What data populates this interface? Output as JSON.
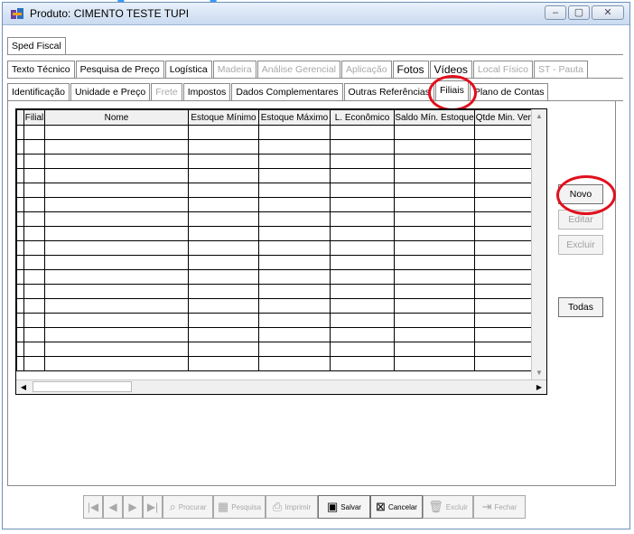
{
  "window": {
    "title": "Produto: CIMENTO TESTE TUPI",
    "controls": [
      "–",
      "▢",
      "✕"
    ]
  },
  "tabs_row1": [
    "Sped Fiscal"
  ],
  "tabs_row2": [
    {
      "label": "Texto Técnico",
      "disabled": false
    },
    {
      "label": "Pesquisa de Preço",
      "disabled": false
    },
    {
      "label": "Logística",
      "disabled": false
    },
    {
      "label": "Madeira",
      "disabled": true
    },
    {
      "label": "Análise Gerencial",
      "disabled": true
    },
    {
      "label": "Aplicação",
      "disabled": true
    },
    {
      "label": "Fotos",
      "disabled": false
    },
    {
      "label": "Vídeos",
      "disabled": false
    },
    {
      "label": "Local Físico",
      "disabled": true
    },
    {
      "label": "ST - Pauta",
      "disabled": true
    }
  ],
  "tabs_row3": [
    {
      "label": "Identificação",
      "disabled": false
    },
    {
      "label": "Unidade e Preço",
      "disabled": false
    },
    {
      "label": "Frete",
      "disabled": true
    },
    {
      "label": "Impostos",
      "disabled": false
    },
    {
      "label": "Dados Complementares",
      "disabled": false
    },
    {
      "label": "Outras Referências",
      "disabled": false
    },
    {
      "label": "Filiais",
      "disabled": false,
      "active": true
    },
    {
      "label": "Plano de Contas",
      "disabled": false
    }
  ],
  "grid": {
    "columns": [
      "",
      "Filial",
      "Nome",
      "Estoque Mínimo",
      "Estoque Máximo",
      "L. Econômico",
      "Saldo Mín. Estoque",
      "Qtde Min. Venda"
    ],
    "empty_rows": 17
  },
  "side_buttons": {
    "novo": "Novo",
    "editar": "Editar",
    "excluir": "Excluir",
    "todas": "Todas"
  },
  "toolbar": {
    "first": "|◀",
    "prev": "◀",
    "next": "▶",
    "last": "▶|",
    "procurar": "Procurar",
    "pesquisa": "Pesquisa",
    "imprimir": "Imprimir",
    "salvar": "Salvar",
    "cancelar": "Cancelar",
    "excluir": "Excluir",
    "fechar": "Fechar"
  },
  "colors": {
    "highlight": "#e0101e",
    "accent": "#1e90ff"
  }
}
